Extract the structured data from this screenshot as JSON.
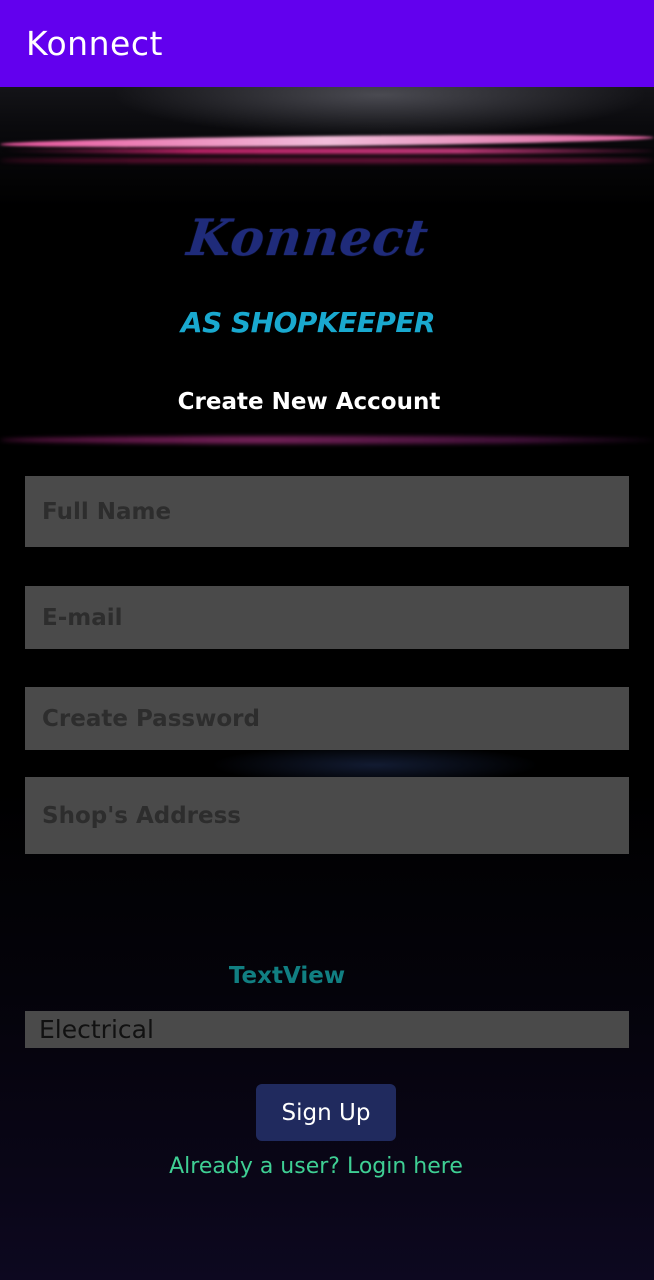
{
  "app_bar": {
    "title": "Konnect"
  },
  "header": {
    "logo_text": "Konnect",
    "role_text": "AS SHOPKEEPER",
    "subtitle": "Create New Account"
  },
  "form": {
    "full_name": {
      "value": "",
      "placeholder": "Full Name"
    },
    "email": {
      "value": "",
      "placeholder": "E-mail"
    },
    "password": {
      "value": "",
      "placeholder": "Create Password"
    },
    "shop_address": {
      "value": "",
      "placeholder": "Shop's Address"
    },
    "category_label": "TextView",
    "category_selected": "Electrical"
  },
  "actions": {
    "signup_label": "Sign Up",
    "login_link": "Already a user? Login here"
  },
  "colors": {
    "app_bar": "#6200ee",
    "logo": "#1f2b7a",
    "role": "#19a9cf",
    "field_bg": "#4a4a4a",
    "textview": "#117f82",
    "button": "#202a5e",
    "link": "#3fcf94"
  }
}
